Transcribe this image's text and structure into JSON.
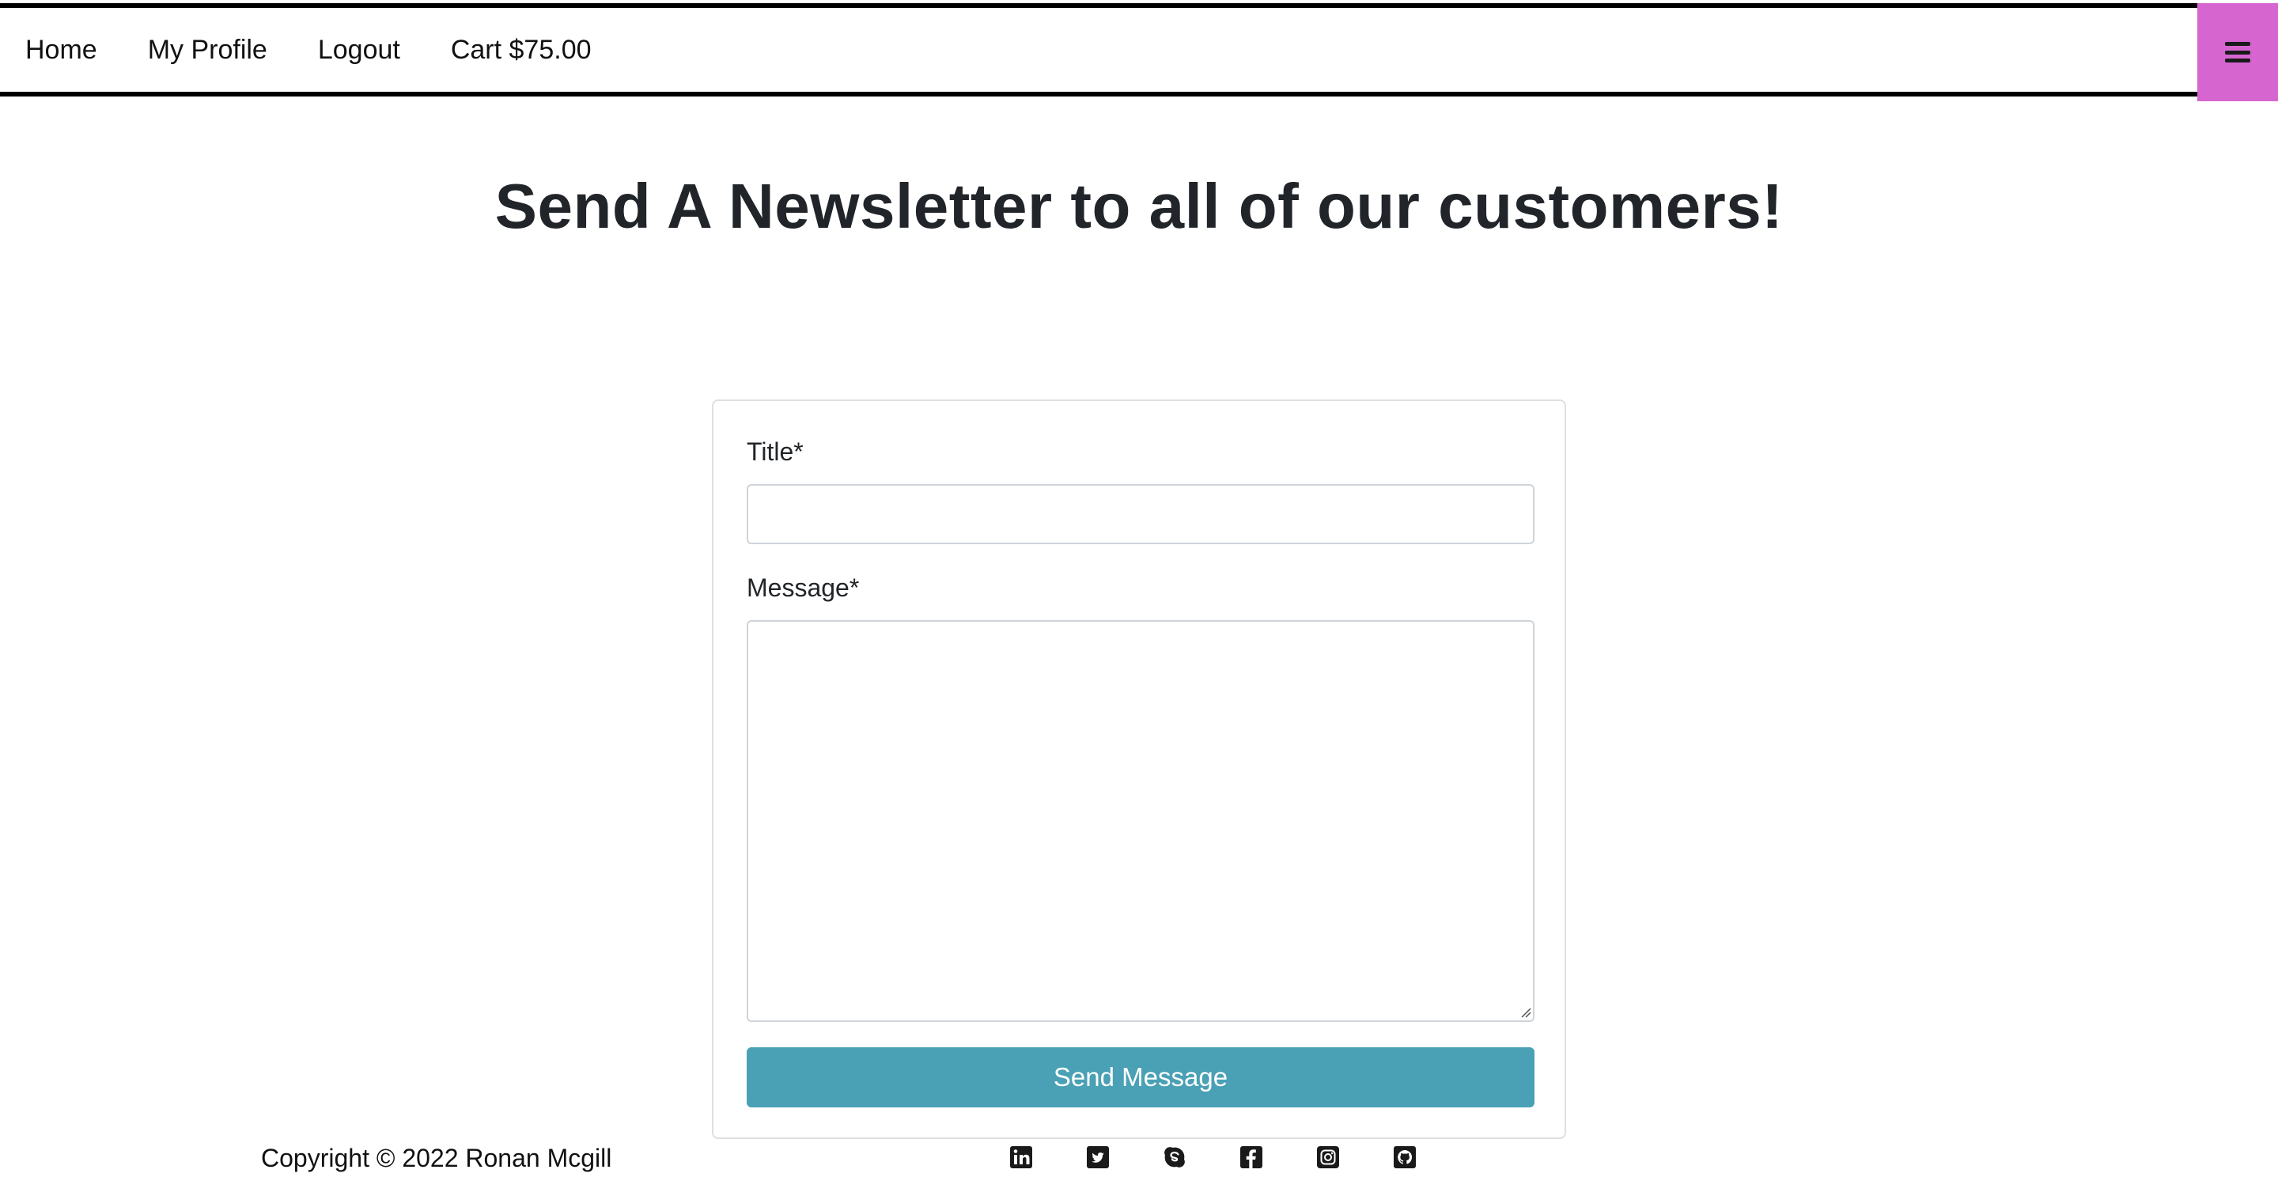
{
  "nav": {
    "links": [
      "Home",
      "My Profile",
      "Logout",
      "Cart $75.00"
    ],
    "menu_icon": "hamburger-menu-icon",
    "menu_color": "#d665d0"
  },
  "main": {
    "heading": "Send A Newsletter to all of our customers!"
  },
  "form": {
    "title_label": "Title*",
    "title_value": "",
    "message_label": "Message*",
    "message_value": "",
    "submit_label": "Send Message",
    "submit_color": "#4aa0b5"
  },
  "footer": {
    "copyright": "Copyright © 2022 Ronan Mcgill",
    "social_icons": [
      "linkedin-icon",
      "twitter-icon",
      "skype-icon",
      "facebook-icon",
      "instagram-icon",
      "github-icon"
    ]
  }
}
